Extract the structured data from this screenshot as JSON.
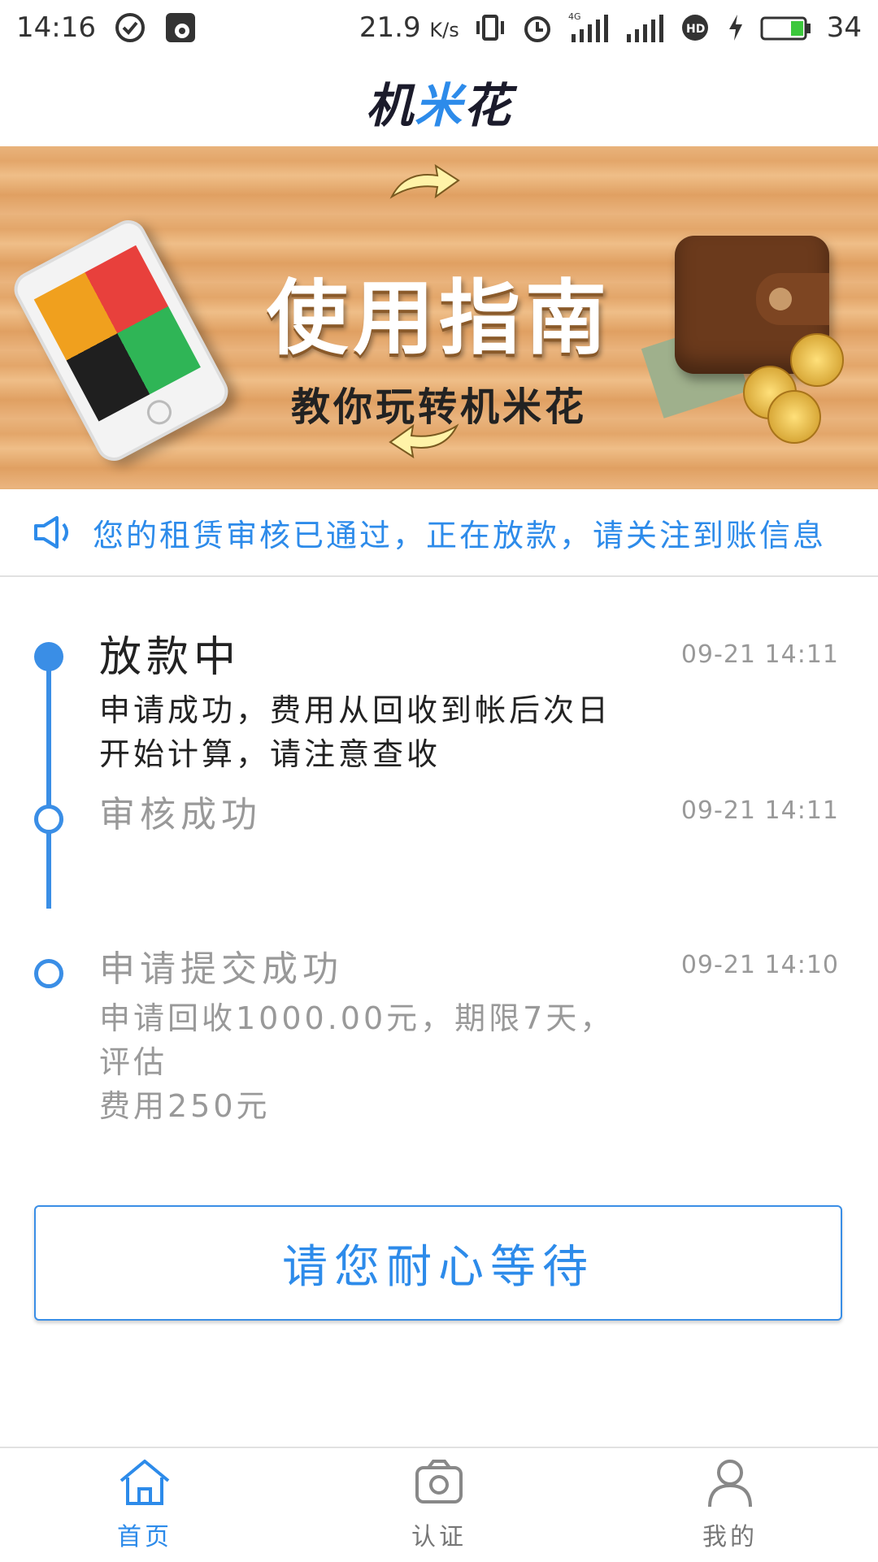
{
  "status_bar": {
    "time": "14:16",
    "net_speed": "21.9",
    "net_unit": "K/s",
    "network": "4G",
    "battery_level": "34"
  },
  "header": {
    "title_part1": "机",
    "title_part2": "米",
    "title_part3": "花"
  },
  "banner": {
    "title": "使用指南",
    "subtitle": "教你玩转机米花"
  },
  "notice": {
    "text": "您的租赁审核已通过，正在放款，请关注到账信息"
  },
  "timeline": [
    {
      "title": "放款中",
      "time": "09-21 14:11",
      "desc_line1": "申请成功，费用从回收到帐后次日",
      "desc_line2": "开始计算，请注意查收",
      "state": "active"
    },
    {
      "title": "审核成功",
      "time": "09-21 14:11",
      "state": "done"
    },
    {
      "title": "申请提交成功",
      "time": "09-21 14:10",
      "desc_line1": "申请回收1000.00元，期限7天，评估",
      "desc_line2": "费用250元",
      "state": "done"
    }
  ],
  "wait_button": {
    "label": "请您耐心等待"
  },
  "bottom_nav": {
    "items": [
      {
        "label": "首页",
        "icon": "home-icon",
        "active": true
      },
      {
        "label": "认证",
        "icon": "camera-icon",
        "active": false
      },
      {
        "label": "我的",
        "icon": "person-icon",
        "active": false
      }
    ]
  },
  "colors": {
    "accent": "#2d8bea",
    "muted": "#999999"
  }
}
